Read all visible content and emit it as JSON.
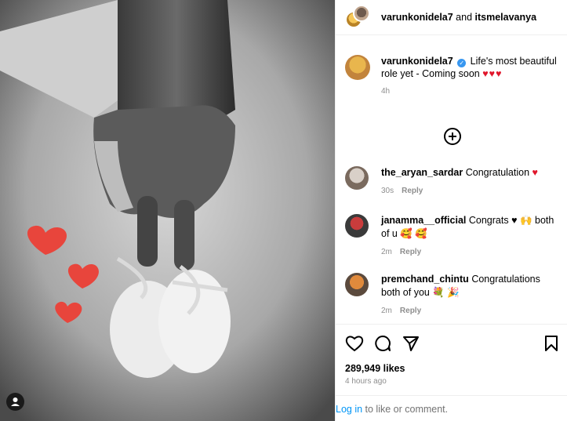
{
  "header": {
    "user1": "varunkonidela7",
    "joiner": " and ",
    "user2": "itsmelavanya"
  },
  "caption": {
    "username": "varunkonidela7",
    "verified_mark": "✓",
    "text": "Life's most beautiful role yet - Coming soon",
    "hearts": "♥♥♥",
    "age": "4h"
  },
  "comments": [
    {
      "username": "the_aryan_sardar",
      "text": "Congratulation",
      "emoji": "♥",
      "age": "30s",
      "reply": "Reply"
    },
    {
      "username": "janamma__official",
      "text": "Congrats",
      "emoji": "♥ 🙌 both of u 🥰 🥰",
      "age": "2m",
      "reply": "Reply"
    },
    {
      "username": "premchand_chintu",
      "text": "Congratulations both of you",
      "emoji": "💐 🎉",
      "age": "2m",
      "reply": "Reply"
    }
  ],
  "stats": {
    "likes": "289,949 likes",
    "time": "4 hours ago"
  },
  "login": {
    "link": "Log in",
    "rest": " to like or comment."
  },
  "colors": {
    "verified": "#3897f0",
    "heart": "#e0162b",
    "link": "#0095f6",
    "muted": "#8e8e8e"
  },
  "icons": {
    "like": "heart-outline-icon",
    "comment": "speech-bubble-icon",
    "share": "paper-plane-icon",
    "save": "bookmark-icon",
    "more": "plus-circle-icon",
    "tags": "person-tag-icon"
  }
}
